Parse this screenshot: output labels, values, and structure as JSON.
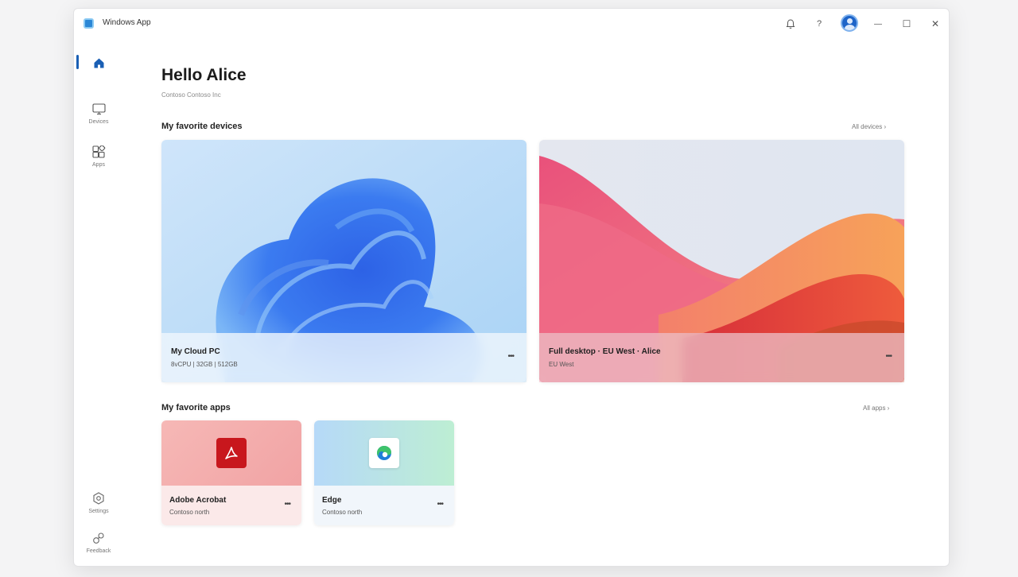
{
  "window": {
    "title": "Windows App"
  },
  "titlebar": {
    "icons": [
      "bell-icon",
      "help-icon",
      "avatar",
      "minimize-icon",
      "maximize-icon",
      "close-icon"
    ],
    "help_glyph": "?",
    "minimize_glyph": "—",
    "maximize_glyph": "☐",
    "close_glyph": "✕"
  },
  "sidebar": {
    "items": [
      {
        "id": "home",
        "label": "",
        "icon": "home-icon",
        "active": true
      },
      {
        "id": "devices",
        "label": "Devices",
        "icon": "monitor-icon"
      },
      {
        "id": "apps",
        "label": "Apps",
        "icon": "apps-icon"
      }
    ],
    "bottom_items": [
      {
        "id": "settings",
        "label": "Settings",
        "icon": "settings-icon"
      },
      {
        "id": "feedback",
        "label": "Feedback",
        "icon": "feedback-icon"
      }
    ]
  },
  "main": {
    "greeting": "Hello Alice",
    "organization": "Contoso Contoso Inc",
    "devices_section": {
      "title": "My favorite devices",
      "see_all": "All devices  ›",
      "cards": [
        {
          "name": "My Cloud PC",
          "detail": "8vCPU | 32GB | 512GB",
          "more": "•••"
        },
        {
          "name": "Full desktop · EU West · Alice",
          "detail": "EU West",
          "more": "•••"
        }
      ]
    },
    "apps_section": {
      "title": "My favorite apps",
      "see_all": "All apps  ›",
      "cards": [
        {
          "name": "Adobe Acrobat",
          "detail": "Contoso north",
          "more": "•••",
          "icon": "acrobat-icon"
        },
        {
          "name": "Edge",
          "detail": "Contoso north",
          "more": "•••",
          "icon": "edge-icon"
        }
      ]
    }
  },
  "colors": {
    "accent": "#1a5fb4",
    "acrobat_red": "#c8171d",
    "edge_blue": "#1e7fd8",
    "edge_green": "#3ec36b"
  }
}
